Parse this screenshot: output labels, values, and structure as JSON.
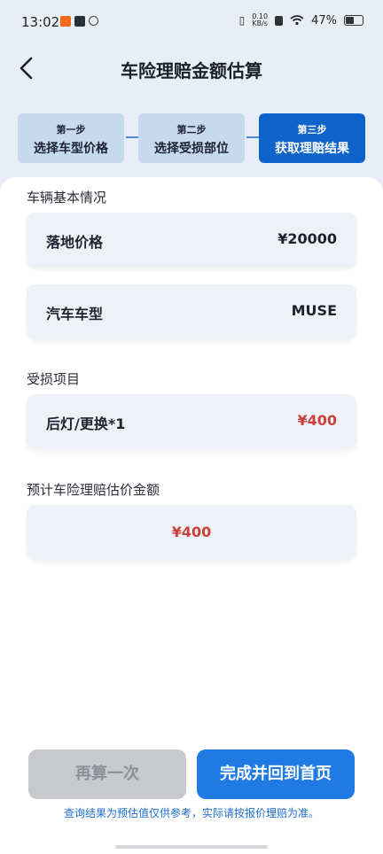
{
  "status_bar": {
    "time": "13:02",
    "net_speed_top": "0.10",
    "net_speed_bottom": "KB/s",
    "battery_percent": "47%",
    "battery_level": 0.47
  },
  "header": {
    "title": "车险理赔金额估算"
  },
  "steps": [
    {
      "step": "第一步",
      "label": "选择车型价格"
    },
    {
      "step": "第二步",
      "label": "选择受损部位"
    },
    {
      "step": "第三步",
      "label": "获取理赔结果"
    }
  ],
  "vehicle": {
    "section_title": "车辆基本情况",
    "price_label": "落地价格",
    "price_value": "¥20000",
    "model_label": "汽车车型",
    "model_value": "MUSE"
  },
  "damage": {
    "section_title": "受损项目",
    "item_label": "后灯/更换*1",
    "item_value": "¥400"
  },
  "estimate": {
    "section_title": "预计车险理赔估价金额",
    "value": "¥400"
  },
  "actions": {
    "recalc_label": "再算一次",
    "done_label": "完成并回到首页"
  },
  "footer_note": "查询结果为预估值仅供参考，实际请按报价理赔为准。",
  "colors": {
    "primary": "#1f7be3",
    "accent_red": "#c9413a",
    "step_done_bg": "#c7d9ee"
  }
}
